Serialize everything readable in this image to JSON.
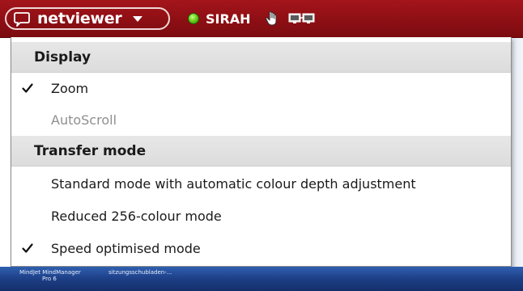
{
  "titlebar": {
    "brand": "netviewer",
    "session_name": "SIRAH",
    "icons": {
      "chat": "chat-bubble-icon",
      "menu": "chevron-down-icon",
      "status": "status-online-icon",
      "control": "hand-icon",
      "screens": "monitor-switch-icon"
    },
    "status_color": "#4fbf12",
    "bar_color": "#8d0f14"
  },
  "menu": {
    "sections": [
      {
        "header": "Display",
        "items": [
          {
            "label": "Zoom",
            "checked": true,
            "enabled": true
          },
          {
            "label": "AutoScroll",
            "checked": false,
            "enabled": false
          }
        ]
      },
      {
        "header": "Transfer mode",
        "items": [
          {
            "label": "Standard mode with automatic colour depth adjustment",
            "checked": false,
            "enabled": true
          },
          {
            "label": "Reduced 256-colour mode",
            "checked": false,
            "enabled": true
          },
          {
            "label": "Speed optimised mode",
            "checked": true,
            "enabled": true
          }
        ]
      }
    ]
  },
  "taskbar": {
    "items": [
      {
        "line1": "MindJet MindManager",
        "line2": "Pro 6"
      },
      {
        "line1": "sitzungsschubladen-...",
        "line2": ""
      }
    ]
  }
}
